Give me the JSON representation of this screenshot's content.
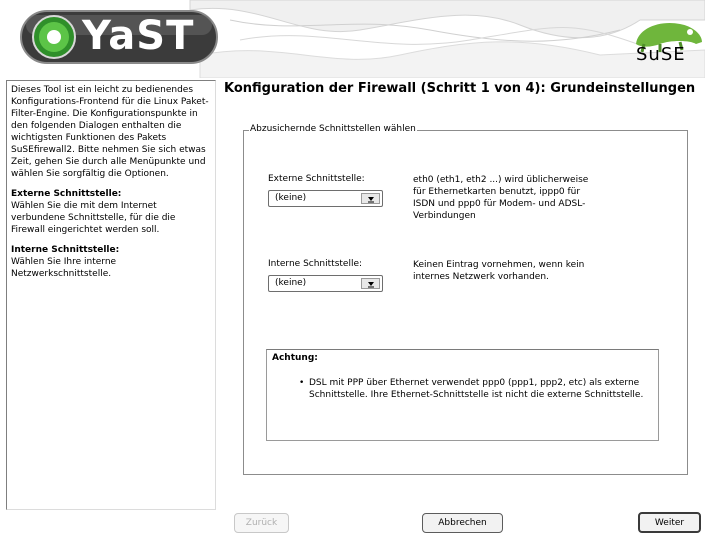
{
  "banner": {
    "logo_text": "YaST",
    "brand_text": "SuSE"
  },
  "help": {
    "intro": "Dieses Tool ist ein leicht zu bedienendes Konfigurations-Frontend für die Linux Paket-Filter-Engine. Die Konfigurationspunkte in den folgenden Dialogen enthalten die wichtigsten Funktionen des Pakets SuSEfirewall2. Bitte nehmen Sie sich etwas Zeit, gehen Sie durch alle Menüpunkte und wählen Sie sorgfältig die Optionen.",
    "external_heading": "Externe Schnittstelle:",
    "external_text": "Wählen Sie die mit dem Internet verbundene Schnittstelle, für die die Firewall eingerichtet werden soll.",
    "internal_heading": "Interne Schnittstelle:",
    "internal_text": "Wählen Sie Ihre interne Netzwerkschnittstelle."
  },
  "main": {
    "title": "Konfiguration der Firewall (Schritt 1 von 4): Grundeinstellungen",
    "frame_label": "Abzusichernde Schnittstellen wählen",
    "external": {
      "label": "Externe Schnittstelle:",
      "value": "(keine)",
      "description": "eth0 (eth1, eth2 ...) wird üblicherweise für Ethernetkarten benutzt, ippp0 für ISDN und ppp0 für Modem- und ADSL-Verbindungen"
    },
    "internal": {
      "label": "Interne Schnittstelle:",
      "value": "(keine)",
      "description": "Keinen Eintrag vornehmen, wenn kein internes Netzwerk vorhanden."
    },
    "warning": {
      "title": "Achtung:",
      "bullet": "•",
      "text": "DSL mit PPP über Ethernet verwendet ppp0 (ppp1, ppp2, etc) als externe Schnittstelle. Ihre Ethernet-Schnittstelle ist nicht die externe Schnittstelle."
    }
  },
  "buttons": {
    "back": "Zurück",
    "abort": "Abbrechen",
    "next": "Weiter"
  },
  "colors": {
    "banner_ribbon": "#e3e3e3",
    "logo_dark": "#4a4a4a",
    "logo_green": "#4aa83a",
    "suse_green": "#6fb63c"
  },
  "icons": {
    "yast": "yast-gear-icon",
    "suse": "suse-chameleon-icon",
    "combo": "dropdown-arrow-icon"
  }
}
